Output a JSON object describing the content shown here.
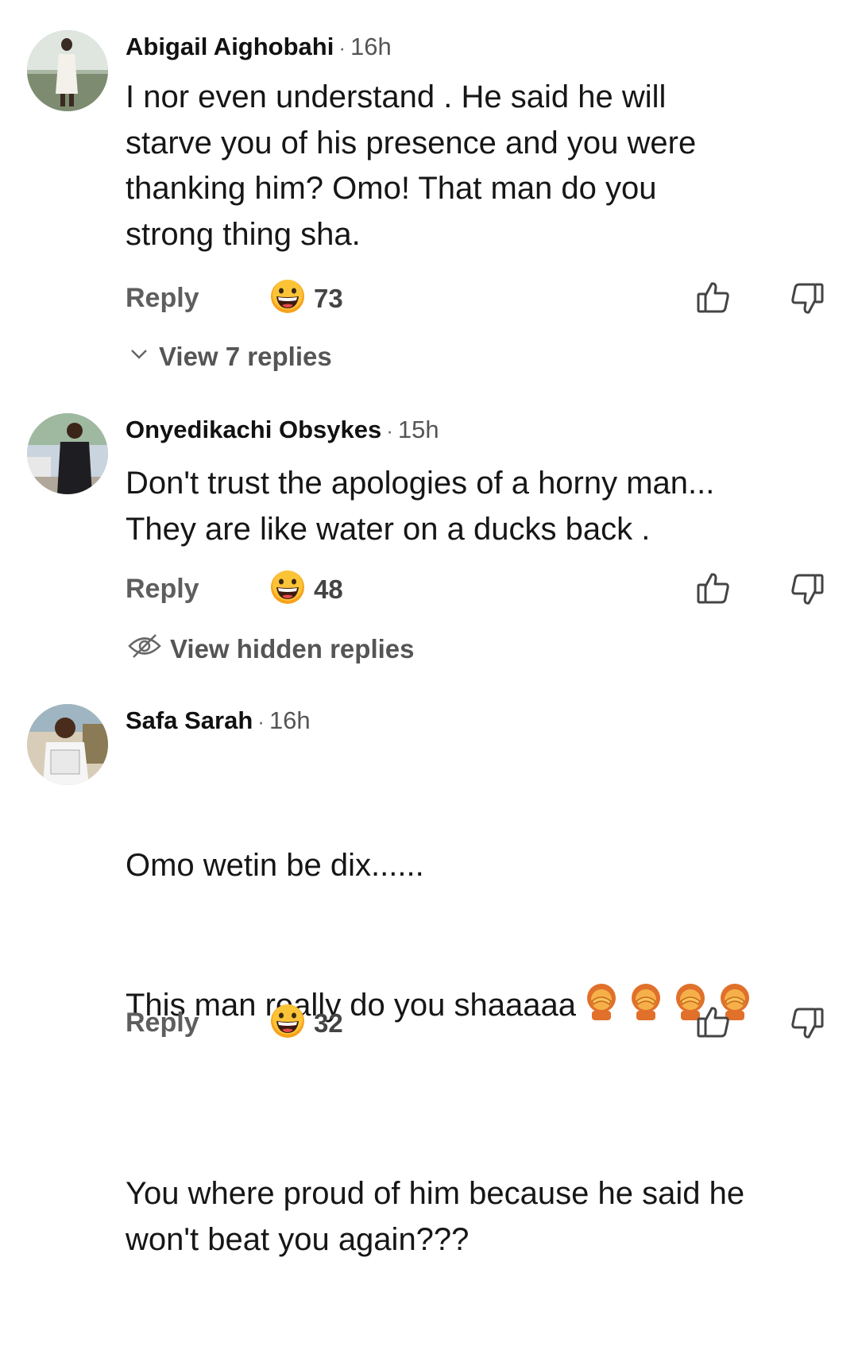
{
  "comments": [
    {
      "author": "Abigail Aighobahi",
      "time": "16h",
      "text": "I nor even understand . He said he will\nstarve you of his presence and you were\nthanking him? Omo! That man do you\nstrong thing sha.",
      "reply_label": "Reply",
      "reaction_count": "73",
      "replies_label": "View 7 replies"
    },
    {
      "author": "Onyedikachi Obsykes",
      "time": "15h",
      "text": "Don't trust the apologies of a horny man...\nThey are like water on a ducks back .",
      "reply_label": "Reply",
      "reaction_count": "48",
      "replies_label": "View hidden replies"
    },
    {
      "author": "Safa Sarah",
      "time": "16h",
      "text_line1": "Omo wetin be dix......",
      "text_line2": "This man really do you shaaaaa",
      "text_line3": "You where proud of him because he said he\nwon't beat you again???",
      "reply_label": "Reply",
      "reaction_count": "32"
    }
  ],
  "colors": {
    "reaction_emoji": "#f7a21b",
    "muted": "#5e5e5e"
  },
  "icons": [
    "grinning-emoji-icon",
    "thumbs-up-icon",
    "thumbs-down-icon",
    "chevron-down-icon",
    "eye-off-icon",
    "facepalm-emoji-icon"
  ]
}
